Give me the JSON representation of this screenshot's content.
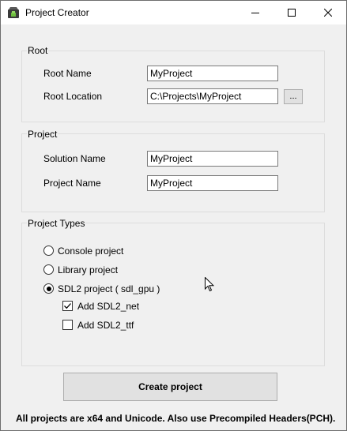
{
  "window": {
    "title": "Project Creator",
    "icon": "app-icon",
    "controls": [
      "minimize-icon",
      "maximize-icon",
      "close-icon"
    ]
  },
  "root_group": {
    "label": "Root",
    "root_name_label": "Root Name",
    "root_name_value": "MyProject",
    "root_location_label": "Root Location",
    "root_location_value": "C:\\Projects\\MyProject",
    "browse_label": "..."
  },
  "project_group": {
    "label": "Project",
    "solution_name_label": "Solution Name",
    "solution_name_value": "MyProject",
    "project_name_label": "Project Name",
    "project_name_value": "MyProject"
  },
  "types_group": {
    "label": "Project Types",
    "options": [
      {
        "label": "Console project",
        "selected": false
      },
      {
        "label": "Library project",
        "selected": false
      },
      {
        "label": "SDL2 project ( sdl_gpu )",
        "selected": true
      }
    ],
    "addons": [
      {
        "label": "Add SDL2_net",
        "checked": true
      },
      {
        "label": "Add SDL2_ttf",
        "checked": false
      }
    ]
  },
  "create_button_label": "Create project",
  "footer_note": "All projects are x64 and Unicode. Also use Precompiled Headers(PCH).",
  "colors": {
    "window_bg": "#f0f0f0",
    "titlebar_bg": "#ffffff",
    "button_bg": "#e1e1e1",
    "group_border": "#dcdcdc"
  }
}
